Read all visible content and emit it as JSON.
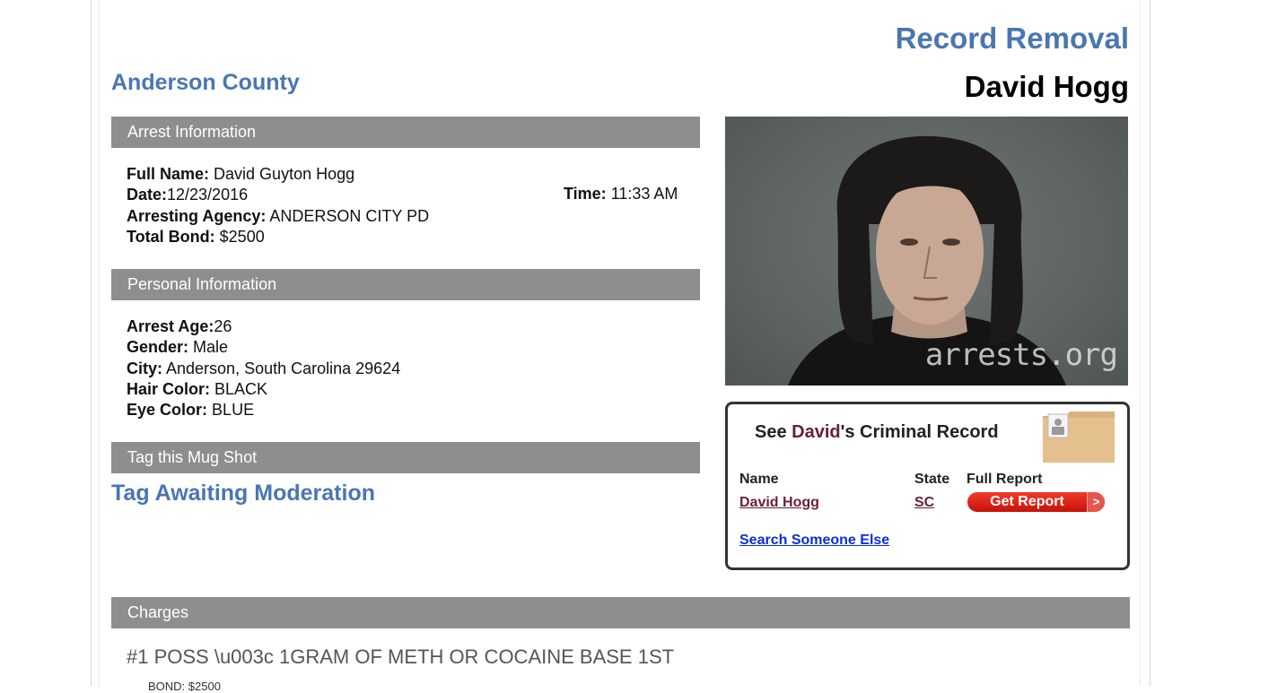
{
  "header": {
    "record_removal": "Record Removal",
    "person_name": "David Hogg",
    "county": "Anderson County"
  },
  "arrest": {
    "section_title": "Arrest Information",
    "full_name_label": "Full Name:",
    "full_name": "David Guyton Hogg",
    "date_label": "Date:",
    "date": "12/23/2016",
    "time_label": "Time:",
    "time": "11:33 AM",
    "agency_label": "Arresting Agency:",
    "agency": "ANDERSON CITY PD",
    "bond_label": "Total Bond:",
    "bond": "$2500"
  },
  "personal": {
    "section_title": "Personal Information",
    "age_label": "Arrest Age:",
    "age": "26",
    "gender_label": "Gender:",
    "gender": "Male",
    "city_label": "City:",
    "city": "Anderson, South Carolina 29624",
    "hair_label": "Hair Color:",
    "hair": "BLACK",
    "eye_label": "Eye Color:",
    "eye": "BLUE"
  },
  "tag": {
    "section_title": "Tag this Mug Shot",
    "status": "Tag Awaiting Moderation"
  },
  "mugshot": {
    "watermark": "arrests.org"
  },
  "criminal_record": {
    "title_prefix": "See ",
    "first_name": "David",
    "title_suffix": "'s Criminal Record",
    "col_name": "Name",
    "col_state": "State",
    "col_report": "Full Report",
    "name_link": "David Hogg",
    "state_link": "SC",
    "report_button": "Get Report",
    "report_arrow": ">",
    "search_else": "Search Someone Else"
  },
  "charges": {
    "section_title": "Charges",
    "charge_1": "#1 POSS \\u003c 1GRAM OF METH OR COCAINE BASE 1ST",
    "bond_1": "BOND: $2500"
  },
  "colors": {
    "link_blue": "#4a76b2",
    "bar_gray": "#8e8e8e",
    "maroon": "#6b1f2f",
    "button_red": "#e0241a"
  }
}
